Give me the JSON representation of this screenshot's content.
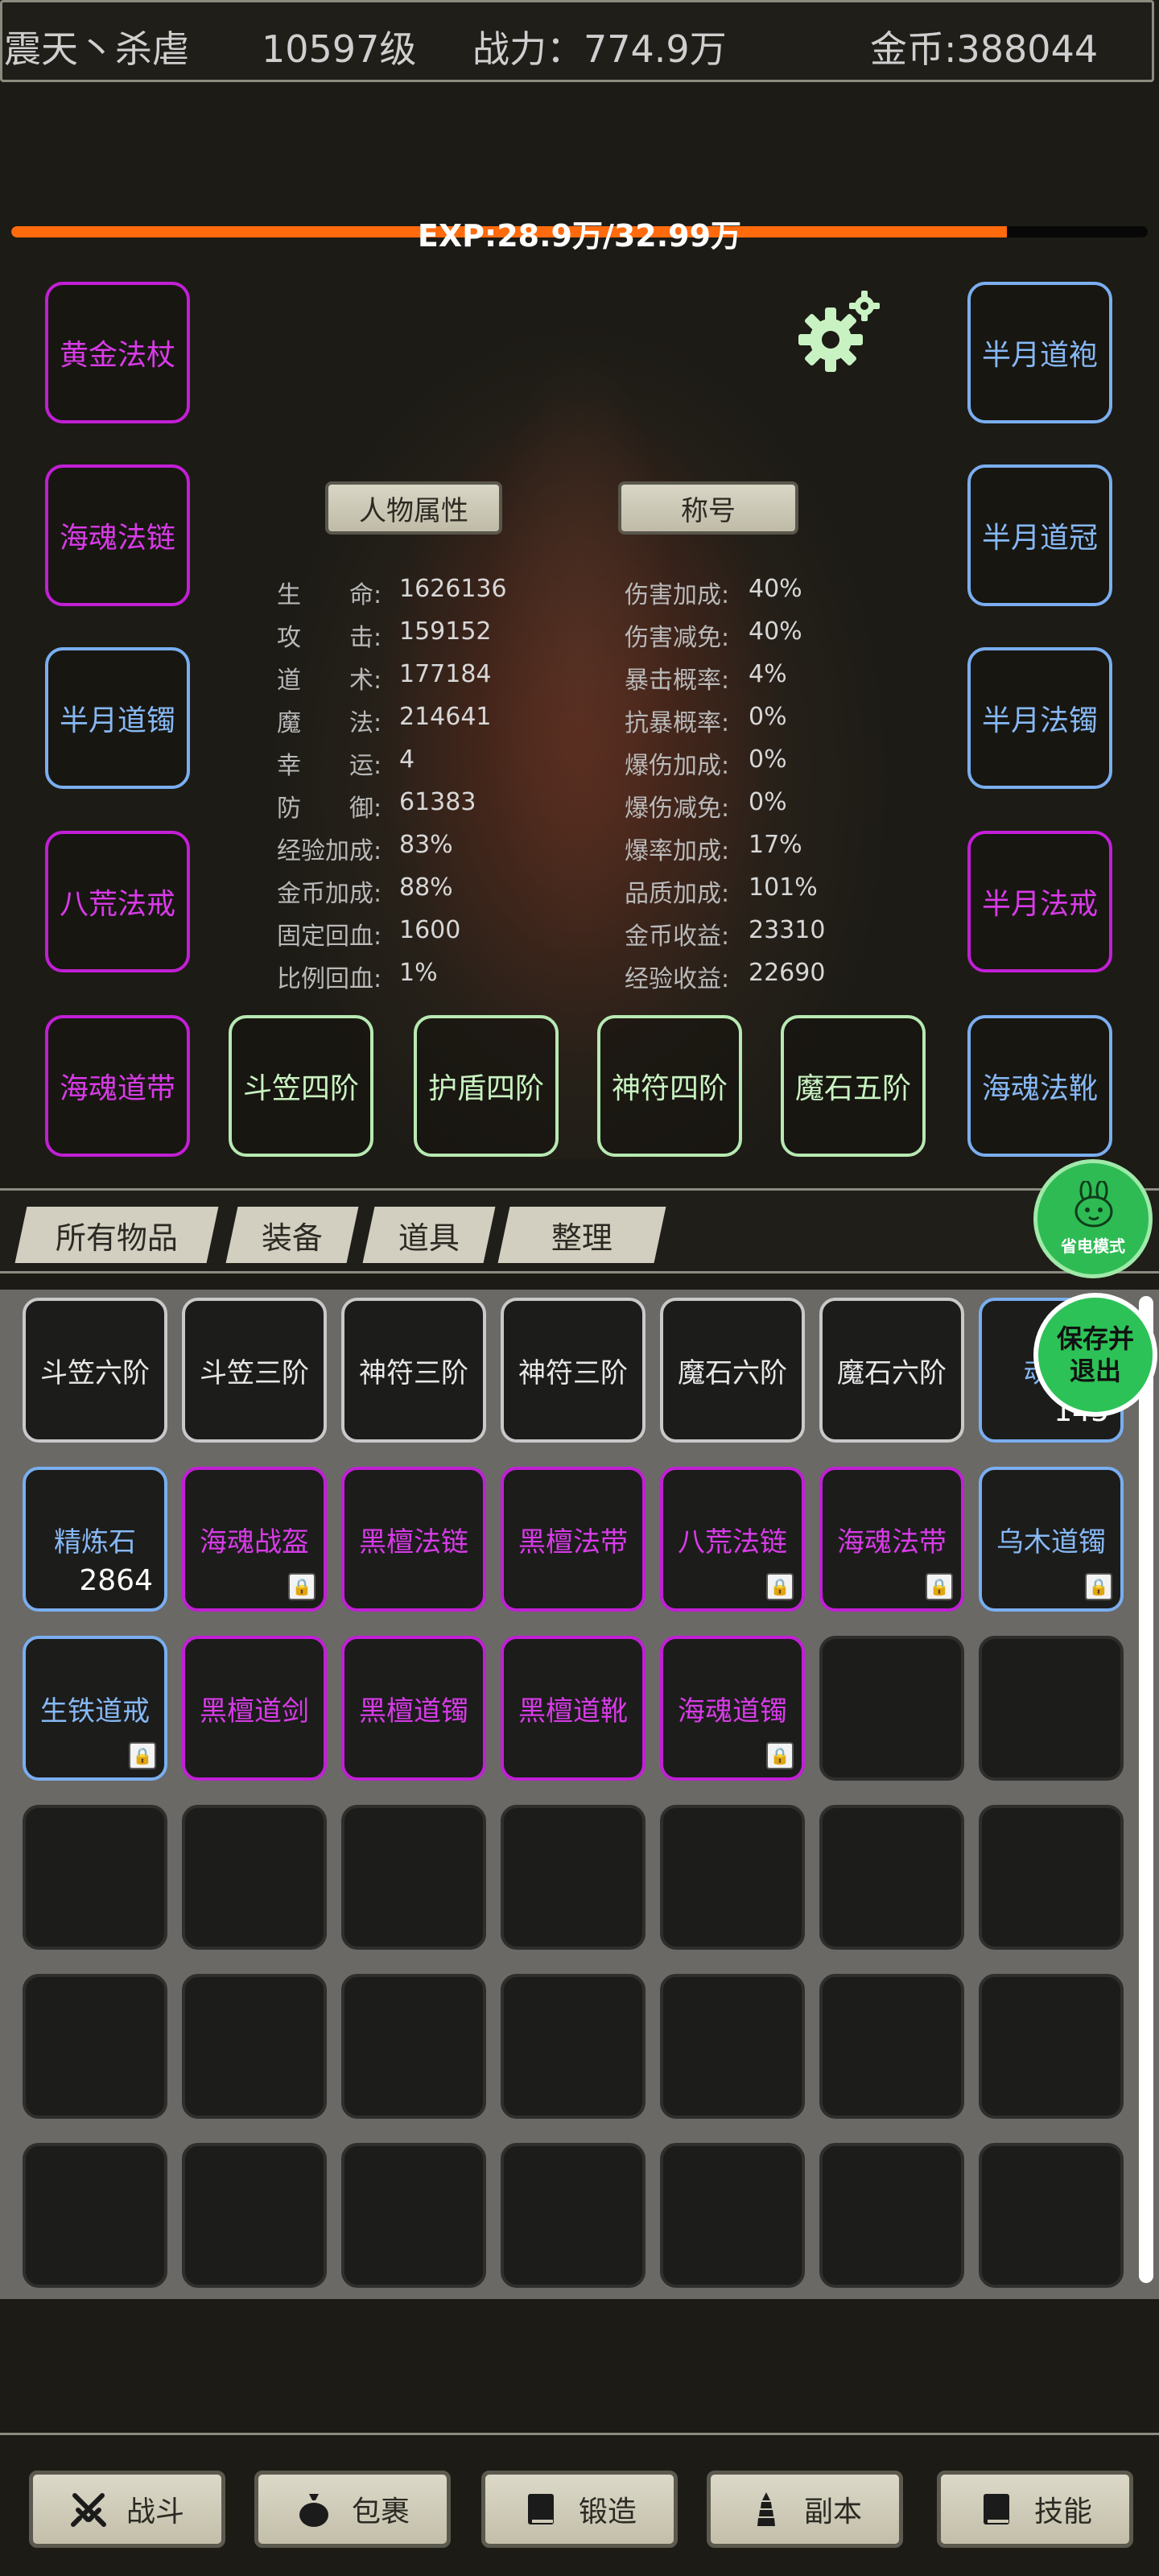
{
  "header": {
    "player_name": "震天丶杀虐",
    "level": "10597级",
    "power": "战力：774.9万",
    "gold": "金币:388044"
  },
  "exp": {
    "text": "EXP:28.9万/32.99万",
    "fraction": 0.876
  },
  "character": {
    "tab_attributes": "人物属性",
    "tab_title": "称号",
    "left_slots": [
      {
        "label": "黄金法杖",
        "quality": "purple"
      },
      {
        "label": "海魂法链",
        "quality": "purple"
      },
      {
        "label": "半月道镯",
        "quality": "blue"
      },
      {
        "label": "八荒法戒",
        "quality": "purple"
      },
      {
        "label": "海魂道带",
        "quality": "purple"
      }
    ],
    "right_slots": [
      {
        "label": "半月道袍",
        "quality": "blue"
      },
      {
        "label": "半月道冠",
        "quality": "blue"
      },
      {
        "label": "半月法镯",
        "quality": "blue"
      },
      {
        "label": "半月法戒",
        "quality": "purple"
      },
      {
        "label": "海魂法靴",
        "quality": "blue"
      }
    ],
    "bottom_slots": [
      {
        "label": "斗笠四阶",
        "quality": "green"
      },
      {
        "label": "护盾四阶",
        "quality": "green"
      },
      {
        "label": "神符四阶",
        "quality": "green"
      },
      {
        "label": "魔石五阶",
        "quality": "green"
      }
    ],
    "stats_left": [
      {
        "label": "生　　命:",
        "value": "1626136"
      },
      {
        "label": "攻　　击:",
        "value": "159152"
      },
      {
        "label": "道　　术:",
        "value": "177184"
      },
      {
        "label": "魔　　法:",
        "value": "214641"
      },
      {
        "label": "幸　　运:",
        "value": "4"
      },
      {
        "label": "防　　御:",
        "value": "61383"
      },
      {
        "label": "经验加成:",
        "value": "83%"
      },
      {
        "label": "金币加成:",
        "value": "88%"
      },
      {
        "label": "固定回血:",
        "value": "1600"
      },
      {
        "label": "比例回血:",
        "value": "1%"
      }
    ],
    "stats_right": [
      {
        "label": "伤害加成:",
        "value": "40%"
      },
      {
        "label": "伤害减免:",
        "value": "40%"
      },
      {
        "label": "暴击概率:",
        "value": "4%"
      },
      {
        "label": "抗暴概率:",
        "value": "0%"
      },
      {
        "label": "爆伤加成:",
        "value": "0%"
      },
      {
        "label": "爆伤减免:",
        "value": "0%"
      },
      {
        "label": "爆率加成:",
        "value": "17%"
      },
      {
        "label": "品质加成:",
        "value": "101%"
      },
      {
        "label": "金币收益:",
        "value": "23310"
      },
      {
        "label": "经验收益:",
        "value": "22690"
      }
    ]
  },
  "inventory": {
    "tabs": [
      "所有物品",
      "装备",
      "道具",
      "整理"
    ],
    "items": [
      {
        "label": "斗笠六阶",
        "quality": "white"
      },
      {
        "label": "斗笠三阶",
        "quality": "white"
      },
      {
        "label": "神符三阶",
        "quality": "white"
      },
      {
        "label": "神符三阶",
        "quality": "white"
      },
      {
        "label": "魔石六阶",
        "quality": "white"
      },
      {
        "label": "魔石六阶",
        "quality": "white"
      },
      {
        "label": "魂珠",
        "quality": "blue",
        "count": "145"
      },
      {
        "label": "精炼石",
        "quality": "blue",
        "count": "2864"
      },
      {
        "label": "海魂战盔",
        "quality": "purple",
        "locked": true
      },
      {
        "label": "黑檀法链",
        "quality": "purple"
      },
      {
        "label": "黑檀法带",
        "quality": "purple"
      },
      {
        "label": "八荒法链",
        "quality": "purple",
        "locked": true
      },
      {
        "label": "海魂法带",
        "quality": "purple",
        "locked": true
      },
      {
        "label": "乌木道镯",
        "quality": "blue",
        "locked": true
      },
      {
        "label": "生铁道戒",
        "quality": "blue",
        "locked": true
      },
      {
        "label": "黑檀道剑",
        "quality": "purple"
      },
      {
        "label": "黑檀道镯",
        "quality": "purple"
      },
      {
        "label": "黑檀道靴",
        "quality": "purple"
      },
      {
        "label": "海魂道镯",
        "quality": "purple",
        "locked": true
      }
    ],
    "total_cells": 42
  },
  "floating": {
    "power_saving": "省电模式",
    "save_exit": "保存并退出"
  },
  "bottom_nav": [
    {
      "label": "战斗",
      "icon": "crossed-swords-icon"
    },
    {
      "label": "包裹",
      "icon": "bag-icon"
    },
    {
      "label": "锻造",
      "icon": "book-icon"
    },
    {
      "label": "副本",
      "icon": "tower-icon"
    },
    {
      "label": "技能",
      "icon": "book-icon"
    }
  ],
  "colors": {
    "purple": "#d83be8",
    "blue": "#86b8f5",
    "green": "#c8f3c1",
    "white": "#e8e8e8",
    "exp_bar": "#ff6a0c",
    "save_button": "#2dc257"
  }
}
